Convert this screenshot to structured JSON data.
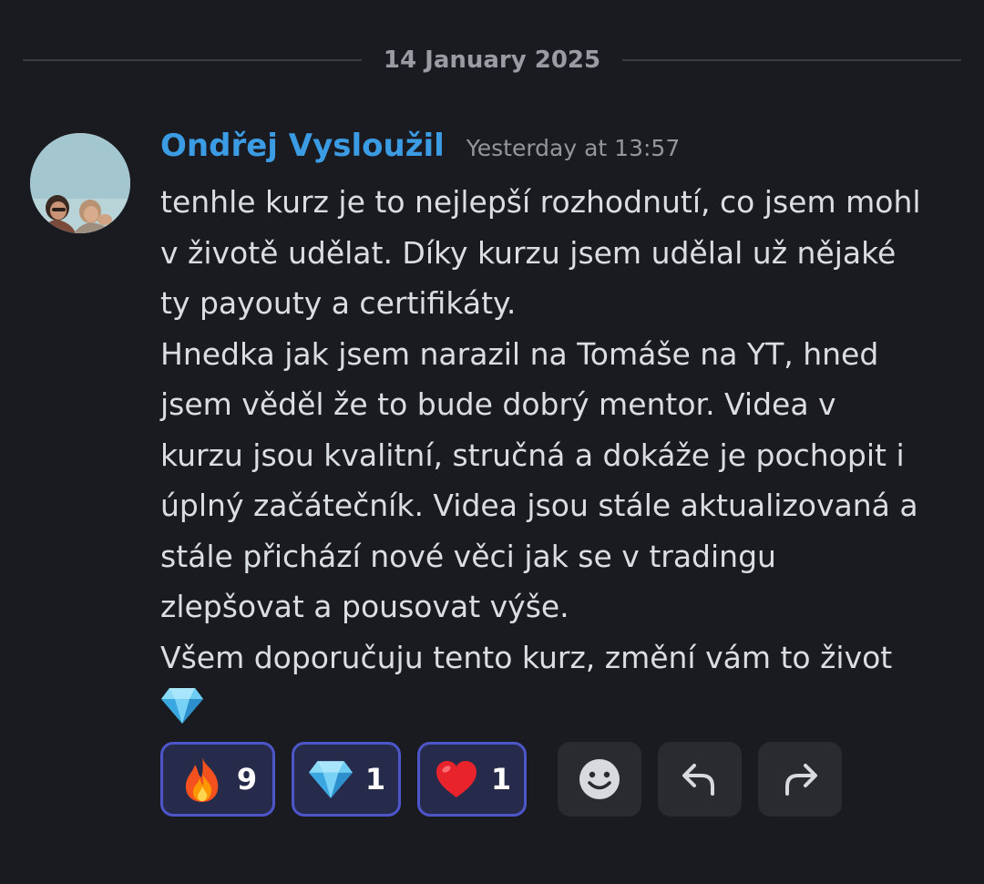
{
  "divider": {
    "date": "14 January 2025"
  },
  "message": {
    "author": "Ondřej Vysloužil",
    "timestamp": "Yesterday at 13:57",
    "lines": [
      "tenhle kurz je to nejlepší rozhodnutí, co jsem mohl",
      "v životě udělat. Díky kurzu jsem udělal už nějaké",
      "ty payouty a certifikáty.",
      "Hnedka jak jsem narazil na Tomáše na YT, hned",
      "jsem věděl že to bude dobrý mentor. Videa v",
      "kurzu jsou kvalitní, stručná a dokáže je pochopit i",
      "úplný začátečník. Videa jsou stále aktualizovaná a",
      "stále přichází nové věci jak se v tradingu",
      "zlepšovat a pousovat výše.",
      "Všem doporučuju tento kurz, změní vám to život"
    ],
    "trailing_emoji_icon": "gem-stone-icon"
  },
  "reactions": [
    {
      "icon": "fire-icon",
      "count": "9"
    },
    {
      "icon": "gem-stone-icon",
      "count": "1"
    },
    {
      "icon": "red-heart-icon",
      "count": "1"
    }
  ],
  "actions": [
    {
      "icon": "add-reaction-smiley-icon"
    },
    {
      "icon": "reply-arrow-icon"
    },
    {
      "icon": "forward-arrow-icon"
    }
  ],
  "colors": {
    "background": "#1a1b20",
    "author": "#3b9ce4",
    "reaction_border": "#4d56c9",
    "reaction_bg": "#262a4b",
    "action_bg": "#2a2b31"
  }
}
